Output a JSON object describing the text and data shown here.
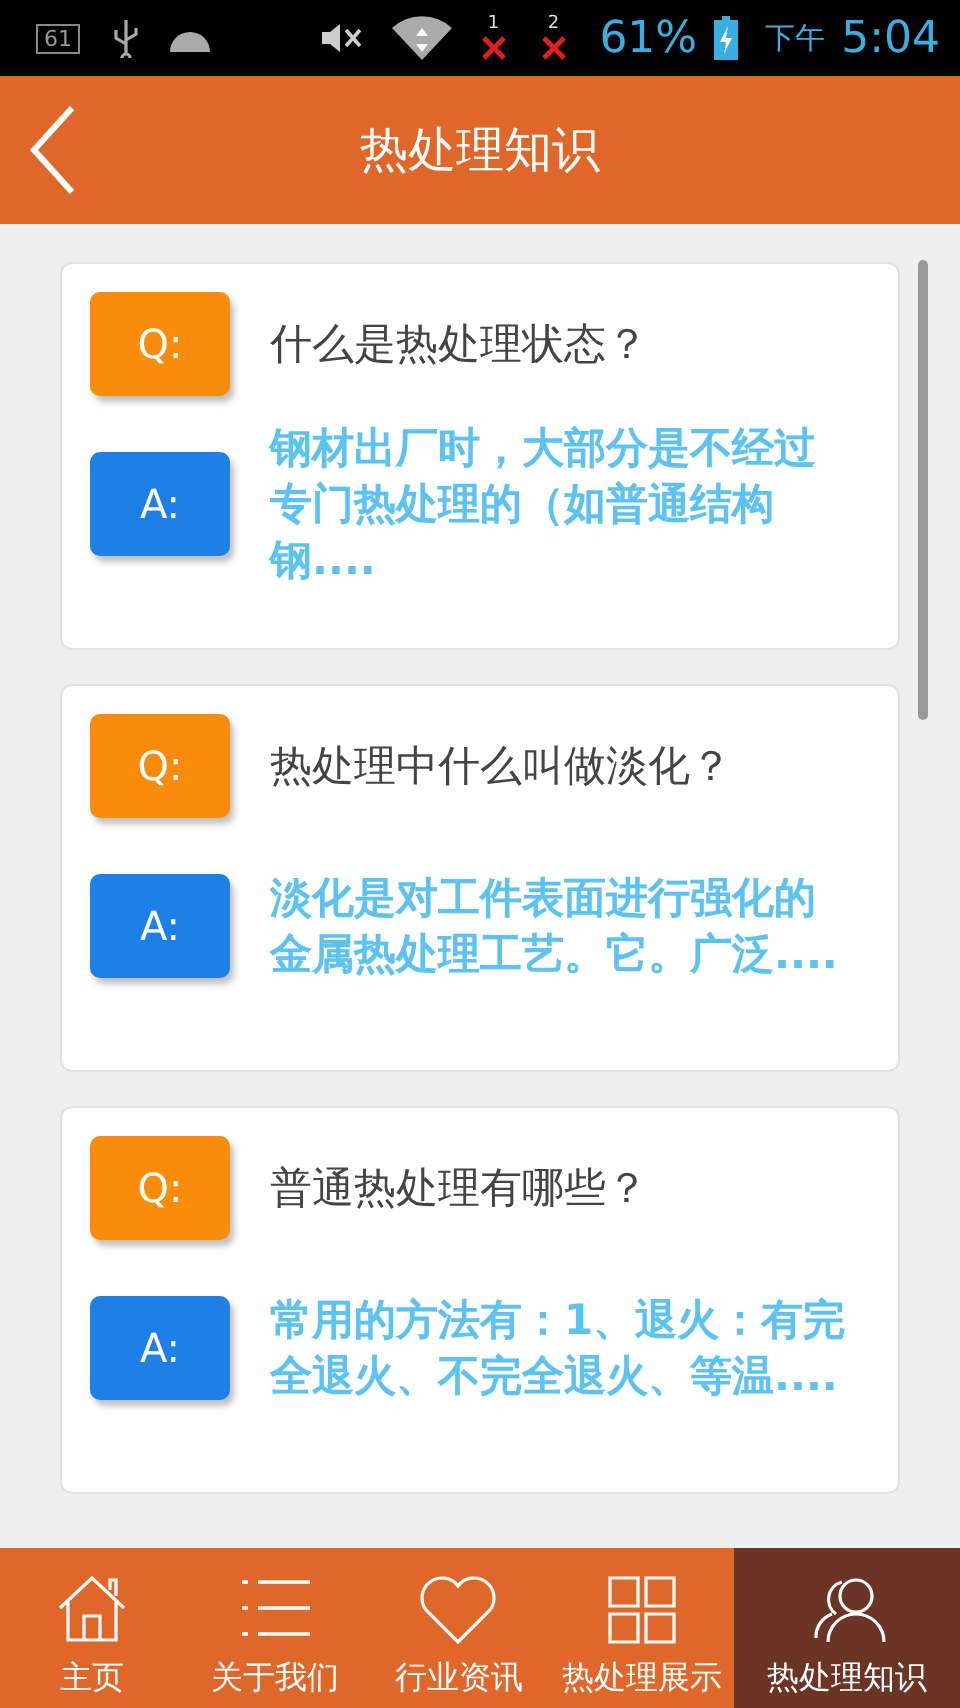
{
  "status_bar": {
    "badge": "61",
    "sim_1": "1",
    "sim_2": "2",
    "battery": "61%",
    "period": "下午",
    "time": "5:04"
  },
  "header": {
    "title": "热处理知识"
  },
  "cards": [
    {
      "q_label": "Q:",
      "question": "什么是热处理状态？",
      "a_label": "A:",
      "answer": "钢材出厂时，大部分是不经过专门热处理的（如普通结构钢...."
    },
    {
      "q_label": "Q:",
      "question": "热处理中什么叫做淡化？",
      "a_label": "A:",
      "answer": "淡化是对工件表面进行强化的金属热处理工艺。它。广泛...."
    },
    {
      "q_label": "Q:",
      "question": "普通热处理有哪些？",
      "a_label": "A:",
      "answer": "常用的方法有：1、退火：有完全退火、不完全退火、等温...."
    }
  ],
  "nav": [
    {
      "kind": "home",
      "label": "主页",
      "selected": false
    },
    {
      "kind": "list",
      "label": "关于我们",
      "selected": false
    },
    {
      "kind": "heart",
      "label": "行业资讯",
      "selected": false
    },
    {
      "kind": "grid",
      "label": "热处理展示",
      "selected": false
    },
    {
      "kind": "people",
      "label": "热处理知识",
      "selected": true
    }
  ]
}
